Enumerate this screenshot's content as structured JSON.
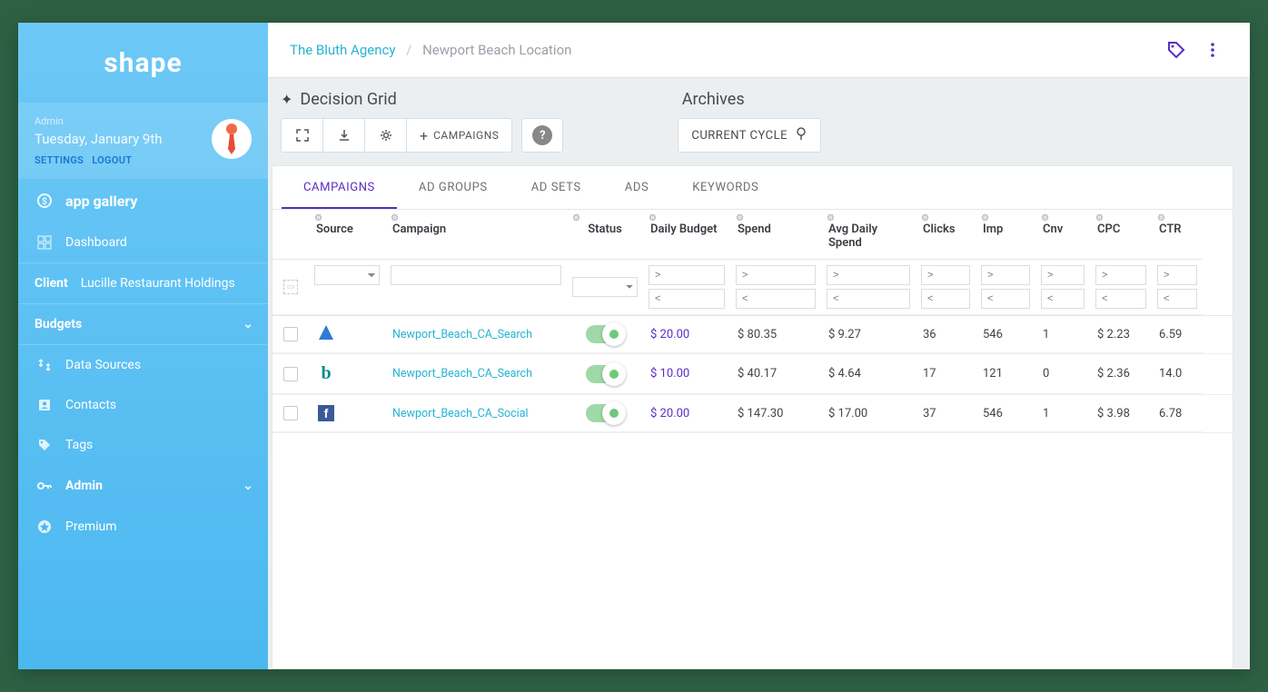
{
  "brand": "shape",
  "user": {
    "role": "Admin",
    "date": "Tuesday, January 9th",
    "settings_link": "SETTINGS",
    "logout_link": "LOGOUT"
  },
  "sidebar": {
    "app_gallery": "app gallery",
    "dashboard": "Dashboard",
    "client_label": "Client",
    "client_value": "Lucille Restaurant Holdings",
    "budgets": "Budgets",
    "data_sources": "Data Sources",
    "contacts": "Contacts",
    "tags": "Tags",
    "admin": "Admin",
    "premium": "Premium"
  },
  "breadcrumb": {
    "root": "The Bluth Agency",
    "current": "Newport Beach Location"
  },
  "sections": {
    "decision_grid": "Decision Grid",
    "archives": "Archives"
  },
  "toolbar": {
    "campaigns_btn": "CAMPAIGNS",
    "current_cycle": "CURRENT CYCLE"
  },
  "tabs": [
    "CAMPAIGNS",
    "AD GROUPS",
    "AD SETS",
    "ADS",
    "KEYWORDS"
  ],
  "columns": {
    "source": "Source",
    "campaign": "Campaign",
    "status": "Status",
    "daily_budget": "Daily Budget",
    "spend": "Spend",
    "avg_daily_spend": "Avg Daily Spend",
    "clicks": "Clicks",
    "imp": "Imp",
    "cnv": "Cnv",
    "cpc": "CPC",
    "ctr": "CTR"
  },
  "filter_placeholders": {
    "gt": ">",
    "lt": "<"
  },
  "rows": [
    {
      "source_icon": "adwords",
      "campaign": "Newport_Beach_CA_Search",
      "status": "on",
      "daily_budget": "$ 20.00",
      "spend": "$ 80.35",
      "avg_daily_spend": "$ 9.27",
      "clicks": "36",
      "imp": "546",
      "cnv": "1",
      "cpc": "$ 2.23",
      "ctr": "6.59"
    },
    {
      "source_icon": "bing",
      "campaign": "Newport_Beach_CA_Search",
      "status": "on",
      "daily_budget": "$ 10.00",
      "spend": "$ 40.17",
      "avg_daily_spend": "$ 4.64",
      "clicks": "17",
      "imp": "121",
      "cnv": "0",
      "cpc": "$ 2.36",
      "ctr": "14.0"
    },
    {
      "source_icon": "facebook",
      "campaign": "Newport_Beach_CA_Social",
      "status": "on",
      "daily_budget": "$ 20.00",
      "spend": "$ 147.30",
      "avg_daily_spend": "$ 17.00",
      "clicks": "37",
      "imp": "546",
      "cnv": "1",
      "cpc": "$ 3.98",
      "ctr": "6.78"
    }
  ]
}
